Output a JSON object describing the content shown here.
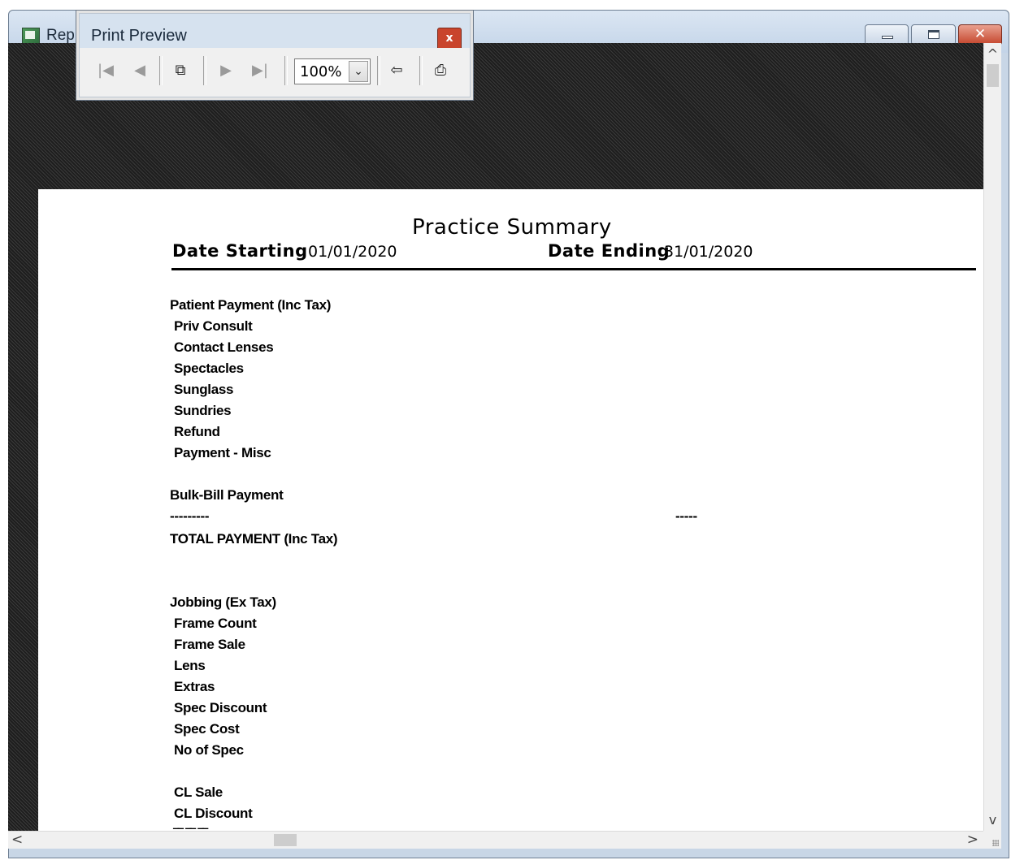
{
  "window": {
    "title": "Rep",
    "close_glyph": "✕"
  },
  "print_preview": {
    "title": "Print Preview",
    "close_glyph": "x",
    "zoom_value": "100%",
    "icons": {
      "first": "|◀",
      "prev": "◀",
      "pages": "⧉",
      "next": "▶",
      "last": "▶|",
      "exit": "⇦",
      "print": "⎙",
      "dropdown": "⌄"
    }
  },
  "report": {
    "title": "Practice Summary",
    "date_starting_label": "Date Starting",
    "date_starting_value": "01/01/2020",
    "date_ending_label": "Date Ending",
    "date_ending_value": "31/01/2020",
    "lines": [
      "Patient Payment (Inc Tax)",
      "Priv Consult",
      "Contact Lenses",
      "Spectacles",
      "Sunglass",
      "Sundries",
      "Refund",
      "Payment - Misc",
      "Bulk-Bill Payment",
      "---------",
      "-----",
      "TOTAL PAYMENT (Inc Tax)",
      "Jobbing (Ex Tax)",
      "Frame Count",
      "Frame Sale",
      "Lens",
      "Extras",
      "Spec Discount",
      "Spec Cost",
      "No of Spec",
      "CL Sale",
      "CL Discount"
    ]
  },
  "scroll": {
    "up": "^",
    "down": "v",
    "left": "<",
    "right": ">"
  }
}
